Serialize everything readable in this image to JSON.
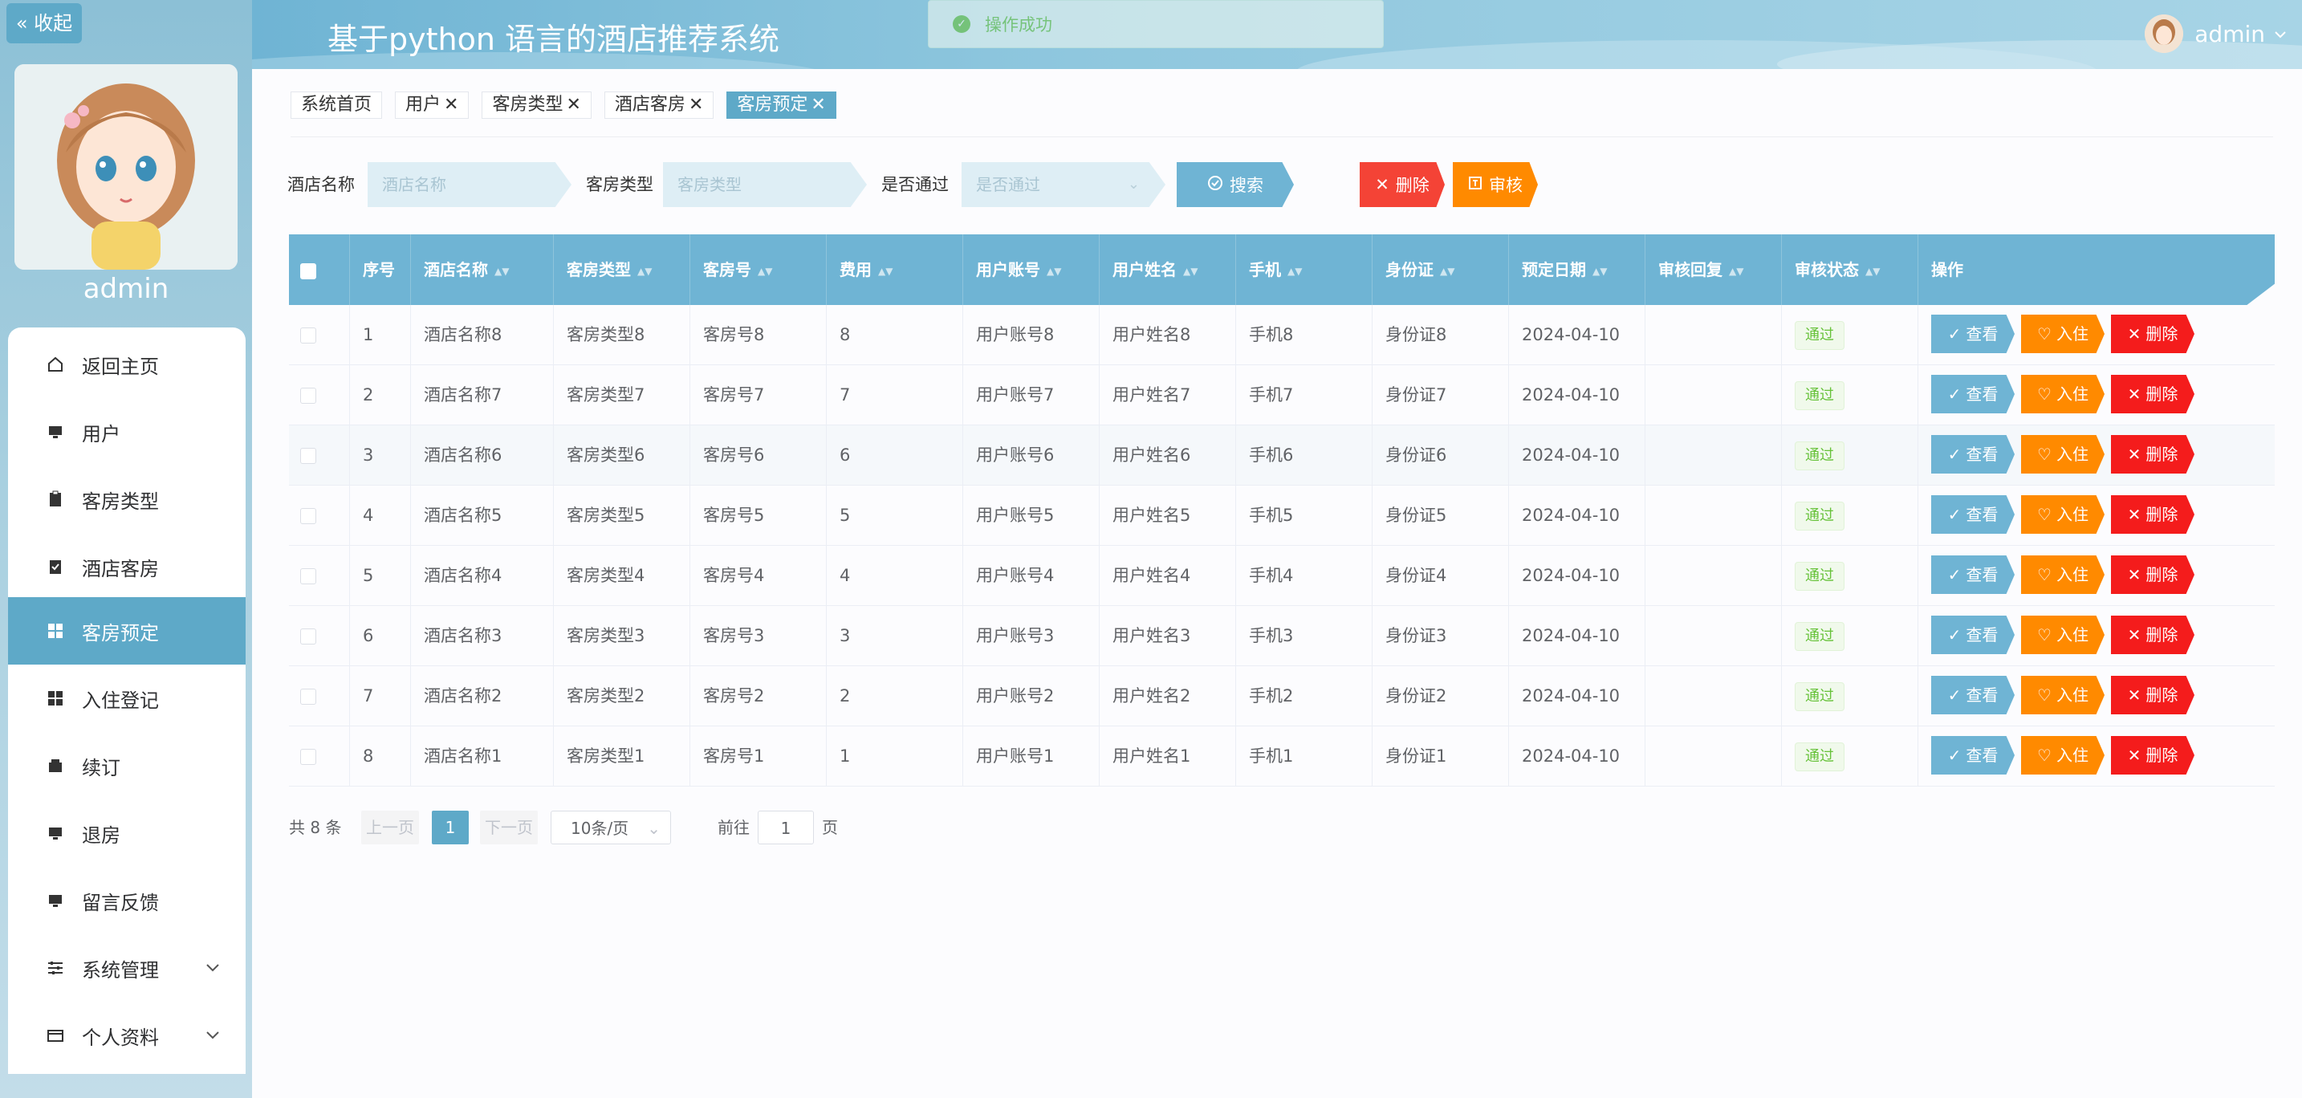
{
  "app": {
    "title": "基于python 语言的酒店推荐系统",
    "collapse_label": "收起",
    "username": "admin"
  },
  "toast": {
    "message": "操作成功"
  },
  "sidebar": {
    "items": [
      {
        "label": "返回主页",
        "icon": "home-icon"
      },
      {
        "label": "用户",
        "icon": "monitor-icon"
      },
      {
        "label": "客房类型",
        "icon": "clipboard-icon"
      },
      {
        "label": "酒店客房",
        "icon": "clipboard-check-icon"
      },
      {
        "label": "客房预定",
        "icon": "grid-icon",
        "active": true
      },
      {
        "label": "入住登记",
        "icon": "grid-icon"
      },
      {
        "label": "续订",
        "icon": "wallet-icon"
      },
      {
        "label": "退房",
        "icon": "monitor-icon"
      },
      {
        "label": "留言反馈",
        "icon": "monitor-icon"
      },
      {
        "label": "系统管理",
        "icon": "sliders-icon",
        "expandable": true
      },
      {
        "label": "个人资料",
        "icon": "card-icon",
        "expandable": true
      }
    ]
  },
  "tags": [
    {
      "label": "系统首页",
      "closable": false
    },
    {
      "label": "用户",
      "closable": true
    },
    {
      "label": "客房类型",
      "closable": true
    },
    {
      "label": "酒店客房",
      "closable": true
    },
    {
      "label": "客房预定",
      "closable": true,
      "active": true
    }
  ],
  "search": {
    "hotel_label": "酒店名称",
    "hotel_placeholder": "酒店名称",
    "type_label": "客房类型",
    "type_placeholder": "客房类型",
    "pass_label": "是否通过",
    "pass_placeholder": "是否通过",
    "search_button": "搜索",
    "delete_button": "删除",
    "audit_button": "审核"
  },
  "table": {
    "columns": [
      "序号",
      "酒店名称",
      "客房类型",
      "客房号",
      "费用",
      "用户账号",
      "用户姓名",
      "手机",
      "身份证",
      "预定日期",
      "审核回复",
      "审核状态",
      "操作"
    ],
    "rows": [
      [
        "1",
        "酒店名称8",
        "客房类型8",
        "客房号8",
        "8",
        "用户账号8",
        "用户姓名8",
        "手机8",
        "身份证8",
        "2024-04-10",
        "",
        "通过"
      ],
      [
        "2",
        "酒店名称7",
        "客房类型7",
        "客房号7",
        "7",
        "用户账号7",
        "用户姓名7",
        "手机7",
        "身份证7",
        "2024-04-10",
        "",
        "通过"
      ],
      [
        "3",
        "酒店名称6",
        "客房类型6",
        "客房号6",
        "6",
        "用户账号6",
        "用户姓名6",
        "手机6",
        "身份证6",
        "2024-04-10",
        "",
        "通过"
      ],
      [
        "4",
        "酒店名称5",
        "客房类型5",
        "客房号5",
        "5",
        "用户账号5",
        "用户姓名5",
        "手机5",
        "身份证5",
        "2024-04-10",
        "",
        "通过"
      ],
      [
        "5",
        "酒店名称4",
        "客房类型4",
        "客房号4",
        "4",
        "用户账号4",
        "用户姓名4",
        "手机4",
        "身份证4",
        "2024-04-10",
        "",
        "通过"
      ],
      [
        "6",
        "酒店名称3",
        "客房类型3",
        "客房号3",
        "3",
        "用户账号3",
        "用户姓名3",
        "手机3",
        "身份证3",
        "2024-04-10",
        "",
        "通过"
      ],
      [
        "7",
        "酒店名称2",
        "客房类型2",
        "客房号2",
        "2",
        "用户账号2",
        "用户姓名2",
        "手机2",
        "身份证2",
        "2024-04-10",
        "",
        "通过"
      ],
      [
        "8",
        "酒店名称1",
        "客房类型1",
        "客房号1",
        "1",
        "用户账号1",
        "用户姓名1",
        "手机1",
        "身份证1",
        "2024-04-10",
        "",
        "通过"
      ]
    ],
    "actions": {
      "view": "查看",
      "checkin": "入住",
      "delete": "删除"
    }
  },
  "pagination": {
    "total": "共 8 条",
    "prev": "上一页",
    "page": "1",
    "next": "下一页",
    "page_size": "10条/页",
    "goto": "前往",
    "goto_value": "1",
    "page_unit": "页"
  },
  "colors": {
    "accent": "#5ea9c8",
    "header": "#6fb4d4",
    "view": "#6fb4d4",
    "checkin": "#ff8a00",
    "delete": "#f41c1c",
    "delete_top": "#f44336",
    "audit": "#ff8a00"
  }
}
